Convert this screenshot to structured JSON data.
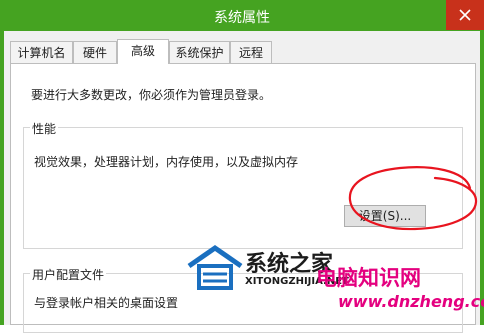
{
  "window": {
    "title": "系统属性",
    "tabs": [
      {
        "label": "计算机名"
      },
      {
        "label": "硬件"
      },
      {
        "label": "高级"
      },
      {
        "label": "系统保护"
      },
      {
        "label": "远程"
      }
    ],
    "active_tab": "高级"
  },
  "advanced": {
    "admin_notice": "要进行大多数更改，你必须作为管理员登录。",
    "performance": {
      "title": "性能",
      "description": "视觉效果，处理器计划，内存使用，以及虚拟内存",
      "settings_button": "设置(S)..."
    },
    "user_profiles": {
      "title": "用户配置文件",
      "description": "与登录帐户相关的桌面设置"
    }
  },
  "watermark": {
    "brand": "系统之家",
    "brand_pinyin": "XITONGZHIJIA.NET",
    "site_name": "电脑知识网",
    "site_url": "www.dnzheng.com"
  },
  "colors": {
    "titlebar": "#45a321",
    "close_button": "#c8311b",
    "annotation_circle": "#e8141f",
    "watermark_pink": "#e4007f",
    "logo_blue": "#1a6fc0"
  }
}
